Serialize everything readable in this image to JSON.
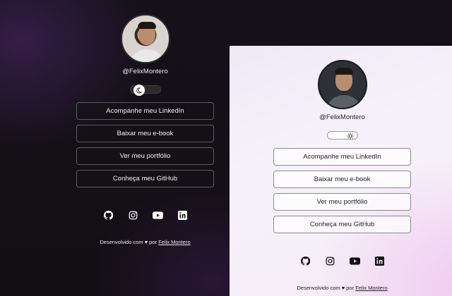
{
  "dark": {
    "username": "@FelixMontero",
    "links": [
      {
        "label": "Acompanhe meu LinkedIn"
      },
      {
        "label": "Baixar meu e-book"
      },
      {
        "label": "Ver meu portfólio"
      },
      {
        "label": "Conheça meu GitHub"
      }
    ],
    "socials": [
      "github-icon",
      "instagram-icon",
      "youtube-icon",
      "linkedin-icon"
    ],
    "footer_text": "Desenvolvido com ♥ por",
    "footer_link": "Felix Montero",
    "colors": {
      "bg": "#121014",
      "text": "#f0f0f0",
      "border": "#5c5a61"
    }
  },
  "light": {
    "username": "@FelixMontero",
    "links": [
      {
        "label": "Acompanhe meu LinkedIn"
      },
      {
        "label": "Baixar meu e-book"
      },
      {
        "label": "Ver meu portfólio"
      },
      {
        "label": "Conheça meu GitHub"
      }
    ],
    "socials": [
      "github-icon",
      "instagram-icon",
      "youtube-icon",
      "linkedin-icon"
    ],
    "footer_text": "Desenvolvido com ♥ por",
    "footer_link": "Felix Montero",
    "colors": {
      "bg": "#f4eef8",
      "text": "#1e1e22",
      "border": "#8b8b93"
    }
  }
}
